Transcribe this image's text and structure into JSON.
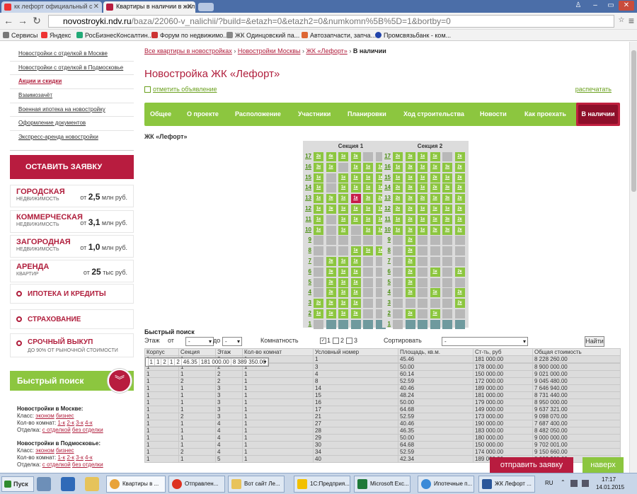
{
  "browser": {
    "tab1": "кк лефорт официальный с",
    "tab2": "Квартиры в наличии в жил",
    "url_host": "novostroyki.ndv.ru",
    "url_path": "/baza/22060-v_nalichii/?build=&etazh=0&etazh2=0&numkomn%5B%5D=1&bortby=0",
    "bookmarks": [
      "Сервисы",
      "Яндекс",
      "РосБизнесКонсалтин...",
      "Форум по недвижимо...",
      "ЖК Одинцовский па...",
      "Автозапчасти, запча...",
      "Промсвязьбанк - ком..."
    ]
  },
  "sidebar": {
    "links": [
      "Новостройки с отделкой в Москве",
      "Новостройки с отделкой в Подмосковье",
      "Акции и скидки",
      "Взаимозачёт",
      "Военная ипотека на новостройку",
      "Оформление документов",
      "Экспресс-аренда новостройки"
    ],
    "cta": "ОСТАВИТЬ ЗАЯВКУ",
    "cats": [
      {
        "t": "ГОРОДСКАЯ",
        "s": "НЕДВИЖИМОСТЬ",
        "pre": "от",
        "n": "2,5",
        "u": "млн руб."
      },
      {
        "t": "КОММЕРЧЕСКАЯ",
        "s": "НЕДВИЖИМОСТЬ",
        "pre": "от",
        "n": "3,1",
        "u": "млн руб."
      },
      {
        "t": "ЗАГОРОДНАЯ",
        "s": "НЕДВИЖИМОСТЬ",
        "pre": "от",
        "n": "1,0",
        "u": "млн руб."
      },
      {
        "t": "АРЕНДА",
        "s": "КВАРТИР",
        "pre": "от",
        "n": "25",
        "u": "тыс руб."
      }
    ],
    "menu": [
      {
        "t": "ИПОТЕКА И КРЕДИТЫ",
        "s": ""
      },
      {
        "t": "СТРАХОВАНИЕ",
        "s": ""
      },
      {
        "t": "СРОЧНЫЙ ВЫКУП",
        "s": "ДО 90% ОТ РЫНОЧНОЙ СТОИМОСТИ"
      }
    ],
    "qs_title": "Быстрый поиск",
    "qs_blocks": [
      {
        "h": "Новостройки в Москве:",
        "k": "Класс:",
        "k1": "эконом",
        "k2": "бизнес",
        "r": "Кол-во комнат:",
        "rooms": [
          "1-к",
          "2-к",
          "3-к",
          "4-к"
        ],
        "o": "Отделка:",
        "o1": "с отделкой",
        "o2": "без отделки"
      },
      {
        "h": "Новостройки в Подмосковье:",
        "k": "Класс:",
        "k1": "эконом",
        "k2": "бизнес",
        "r": "Кол-во комнат:",
        "rooms": [
          "1-к",
          "2-к",
          "3-к",
          "4-к"
        ],
        "o": "Отделка:",
        "o1": "с отделкой",
        "o2": "без отделки"
      }
    ]
  },
  "main": {
    "crumbs": [
      "Все квартиры в новостройках",
      "Новостройки Москвы",
      "ЖК «Лефорт»"
    ],
    "crumb_sep": "›",
    "current": "В наличии",
    "title": "Новостройка ЖК «Лефорт»",
    "mark": "отметить объявление",
    "print": "распечатать",
    "nav": [
      "Общее",
      "О проекте",
      "Расположение",
      "Участники",
      "Планировки",
      "Ход строительства",
      "Новости",
      "Как проехать"
    ],
    "nav_active": "В наличии",
    "complex_label": "ЖК «Лефорт»",
    "sections": [
      {
        "title": "Секция 1",
        "rows": [
          {
            "f": "17",
            "c": [
              "2к",
              "4к",
              "1к",
              "3к",
              ""
            ]
          },
          {
            "f": "16",
            "c": [
              "3к",
              "1к",
              "",
              "1к",
              "1к",
              "1к"
            ]
          },
          {
            "f": "15",
            "c": [
              "1к",
              "",
              "1к",
              "1к",
              "1к",
              "1к"
            ]
          },
          {
            "f": "14",
            "c": [
              "1к",
              "",
              "1к",
              "1к",
              "1к",
              "1к"
            ]
          },
          {
            "f": "13",
            "c": [
              "1к",
              "3к",
              "1к",
              "1к*",
              "3к",
              "2к"
            ]
          },
          {
            "f": "12",
            "c": [
              "1к",
              "3к",
              "1к",
              "1к",
              "1к",
              "1к"
            ]
          },
          {
            "f": "11",
            "c": [
              "1к",
              "",
              "1к",
              "1к",
              "1к",
              "1к"
            ]
          },
          {
            "f": "10",
            "c": [
              "1к",
              "",
              "1к",
              "",
              "1к",
              "1к"
            ]
          },
          {
            "f": "9",
            "c": [
              "",
              "",
              "",
              "",
              "",
              ""
            ]
          },
          {
            "f": "8",
            "c": [
              "",
              "",
              "",
              "1к",
              "1к",
              "1к"
            ]
          },
          {
            "f": "7",
            "c": [
              "",
              "3к",
              "1к",
              "1к",
              "",
              ""
            ]
          },
          {
            "f": "6",
            "c": [
              "",
              "3к",
              "1к",
              "1к",
              "",
              ""
            ]
          },
          {
            "f": "5",
            "c": [
              "",
              "3к",
              "1к",
              "1к",
              "",
              ""
            ]
          },
          {
            "f": "4",
            "c": [
              "",
              "3к",
              "1к",
              "1к",
              "",
              ""
            ]
          },
          {
            "f": "3",
            "c": [
              "2к",
              "3к",
              "1к",
              "1к",
              "",
              ""
            ]
          },
          {
            "f": "2",
            "c": [
              "1к",
              "1к",
              "1к",
              "3к",
              "",
              ""
            ]
          },
          {
            "f": "1",
            "c": [
              "",
              "",
              "",
              "",
              "",
              ""
            ]
          }
        ]
      },
      {
        "title": "Секция 2",
        "rows": [
          {
            "f": "17",
            "c": [
              "2к",
              "3к",
              "1к",
              "1к",
              "",
              "2к"
            ]
          },
          {
            "f": "16",
            "c": [
              "1к",
              "3к",
              "1к",
              "1к",
              "3к",
              "2к"
            ]
          },
          {
            "f": "15",
            "c": [
              "1к",
              "1к",
              "1к",
              "2к",
              "1к",
              "2к"
            ]
          },
          {
            "f": "14",
            "c": [
              "2к",
              "3к",
              "1к",
              "2к",
              "3к",
              "2к"
            ]
          },
          {
            "f": "13",
            "c": [
              "2к",
              "3к",
              "2к",
              "1к",
              "3к",
              "2к"
            ]
          },
          {
            "f": "12",
            "c": [
              "2к",
              "2к",
              "1к",
              "1к",
              "1к",
              "2к"
            ]
          },
          {
            "f": "11",
            "c": [
              "1к",
              "2к",
              "1к",
              "1к",
              "3к",
              "2к"
            ]
          },
          {
            "f": "10",
            "c": [
              "1к",
              "3к",
              "1к",
              "3к",
              "3к",
              "2к"
            ]
          },
          {
            "f": "9",
            "c": [
              "",
              "2к",
              "",
              "",
              "",
              ""
            ]
          },
          {
            "f": "8",
            "c": [
              "",
              "2к",
              "",
              "",
              "",
              ""
            ]
          },
          {
            "f": "7",
            "c": [
              "",
              "2к",
              "",
              "",
              "",
              ""
            ]
          },
          {
            "f": "6",
            "c": [
              "",
              "2к",
              "",
              "1к",
              "",
              "2к"
            ]
          },
          {
            "f": "5",
            "c": [
              "",
              "3к",
              "",
              "",
              "",
              ""
            ]
          },
          {
            "f": "4",
            "c": [
              "",
              "3к",
              "",
              "1к",
              "",
              "2к"
            ]
          },
          {
            "f": "3",
            "c": [
              "",
              "",
              "",
              "",
              "",
              "2к"
            ]
          },
          {
            "f": "2",
            "c": [
              "",
              "2к",
              "",
              "1к",
              "",
              ""
            ]
          },
          {
            "f": "1",
            "c": [
              "",
              "",
              "",
              "",
              "",
              ""
            ]
          }
        ]
      }
    ],
    "qs": {
      "title": "Быстрый поиск",
      "floor": "Этаж",
      "from": "от",
      "to": "до",
      "dash": "-",
      "rooms": "Комнатность",
      "r1": "1",
      "r2": "2",
      "r3": "3",
      "sort": "Сортировать",
      "find": "Найти"
    },
    "table_headers": [
      "Корпус",
      "Секция",
      "Этаж",
      "Кол-во комнат",
      "Условный номер",
      "Площадь, кв.м.",
      "Ст-ть, руб",
      "Общая стоимость"
    ],
    "table_rows": [
      [
        "1",
        "1",
        "2",
        "1",
        "1",
        "45.46",
        "181 000.00",
        "8 228 260.00"
      ],
      [
        "1",
        "1",
        "2",
        "1",
        "2",
        "46.35",
        "181 000.00",
        "8 389 350.00"
      ],
      [
        "1",
        "1",
        "2",
        "1",
        "3",
        "50.00",
        "178 000.00",
        "8 900 000.00"
      ],
      [
        "1",
        "1",
        "2",
        "1",
        "4",
        "60.14",
        "150 000.00",
        "9 021 000.00"
      ],
      [
        "1",
        "2",
        "2",
        "1",
        "8",
        "52.59",
        "172 000.00",
        "9 045 480.00"
      ],
      [
        "1",
        "1",
        "3",
        "1",
        "14",
        "40.46",
        "189 000.00",
        "7 646 940.00"
      ],
      [
        "1",
        "1",
        "3",
        "1",
        "15",
        "48.24",
        "181 000.00",
        "8 731 440.00"
      ],
      [
        "1",
        "1",
        "3",
        "1",
        "16",
        "50.00",
        "179 000.00",
        "8 950 000.00"
      ],
      [
        "1",
        "1",
        "3",
        "1",
        "17",
        "64.68",
        "149 000.00",
        "9 637 321.00"
      ],
      [
        "1",
        "2",
        "3",
        "1",
        "21",
        "52.59",
        "173 000.00",
        "9 098 070.00"
      ],
      [
        "1",
        "1",
        "4",
        "1",
        "27",
        "40.46",
        "190 000.00",
        "7 687 400.00"
      ],
      [
        "1",
        "1",
        "4",
        "1",
        "28",
        "46.35",
        "183 000.00",
        "8 482 050.00"
      ],
      [
        "1",
        "1",
        "4",
        "1",
        "29",
        "50.00",
        "180 000.00",
        "9 000 000.00"
      ],
      [
        "1",
        "1",
        "4",
        "1",
        "30",
        "64.68",
        "150 000.00",
        "9 702 001.00"
      ],
      [
        "1",
        "2",
        "4",
        "1",
        "34",
        "52.59",
        "174 000.00",
        "9 150 660.00"
      ],
      [
        "1",
        "1",
        "5",
        "1",
        "40",
        "42.34",
        "189 000.00",
        "8 002 260.00"
      ]
    ],
    "send": "отправить заявку",
    "up": "наверх"
  },
  "taskbar": {
    "start": "Пуск",
    "tasks": [
      "Квартиры в ...",
      "Отправлен...",
      "Вот сайт Ле...",
      "1С:Предприя...",
      "Microsoft Exc...",
      "Ипотечные п...",
      "ЖК Лефорт ..."
    ],
    "lang": "RU",
    "time": "17:17",
    "date": "14.01.2015"
  }
}
